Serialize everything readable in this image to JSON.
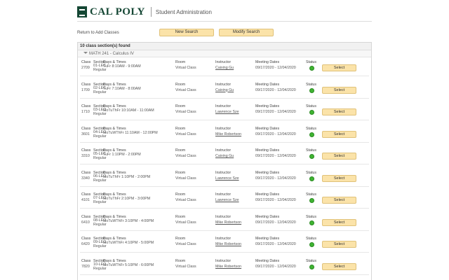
{
  "header": {
    "brand": "CAL POLY",
    "app_title": "Student Administration"
  },
  "toolbar": {
    "return_label": "Return to Add Classes",
    "new_search": "New Search",
    "modify_search": "Modify Search"
  },
  "results": {
    "count_label": "10 class section(s) found",
    "course_title": "MATH 241 - Calculus IV"
  },
  "columns": {
    "class": "Class",
    "section": "Section",
    "days_times": "Days & Times",
    "room": "Room",
    "instructor": "Instructor",
    "meeting_dates": "Meeting Dates",
    "status": "Status"
  },
  "select_label": "Select",
  "status_color": "#3fb432",
  "rows": [
    {
      "class": "2709",
      "section": "01-LEC Regular",
      "days": "TuFr 8:10AM - 9:00AM",
      "room": "Virtual Class",
      "instructor": "Caixing Gu",
      "dates": "09/17/2020 - 12/04/2020",
      "status": "open"
    },
    {
      "class": "1709",
      "section": "02-LEC Regular",
      "days": "TuFr 7:10AM - 8:00AM",
      "room": "Virtual Class",
      "instructor": "Caixing Gu",
      "dates": "09/17/2020 - 12/04/2020",
      "status": "open"
    },
    {
      "class": "1710",
      "section": "03-LEC Regular",
      "days": "MoTuThFr 10:10AM - 11:00AM",
      "room": "Virtual Class",
      "instructor": "Lawrence Sze",
      "dates": "09/17/2020 - 12/04/2020",
      "status": "open"
    },
    {
      "class": "3601",
      "section": "04-LEC Regular",
      "days": "MoTuWThFr 11:10AM - 12:00PM",
      "room": "Virtual Class",
      "instructor": "Mike Robertson",
      "dates": "09/17/2020 - 12/04/2020",
      "status": "open"
    },
    {
      "class": "3310",
      "section": "05-LEC Regular",
      "days": "TuFr 1:10PM - 2:00PM",
      "room": "Virtual Class",
      "instructor": "Caixing Gu",
      "dates": "09/17/2020 - 12/04/2020",
      "status": "open"
    },
    {
      "class": "3340",
      "section": "06-LEC Regular",
      "days": "MoTuThFr 1:10PM - 2:00PM",
      "room": "Virtual Class",
      "instructor": "Lawrence Sze",
      "dates": "09/17/2020 - 12/04/2020",
      "status": "open"
    },
    {
      "class": "4101",
      "section": "07-LEC Regular",
      "days": "MoTuThFr 2:10PM - 3:00PM",
      "room": "Virtual Class",
      "instructor": "Lawrence Sze",
      "dates": "09/17/2020 - 12/04/2020",
      "status": "open"
    },
    {
      "class": "6410",
      "section": "08-LEC Regular",
      "days": "MoTuWThFr 3:10PM - 4:00PM",
      "room": "Virtual Class",
      "instructor": "Mike Robertson",
      "dates": "09/17/2020 - 12/04/2020",
      "status": "open"
    },
    {
      "class": "6420",
      "section": "09-LEC Regular",
      "days": "MoTuWThFr 4:10PM - 5:00PM",
      "room": "Virtual Class",
      "instructor": "Mike Robertson",
      "dates": "09/17/2020 - 12/04/2020",
      "status": "open"
    },
    {
      "class": "7820",
      "section": "10-LEC Regular",
      "days": "MoTuWThFr 5:10PM - 6:00PM",
      "room": "Virtual Class",
      "instructor": "Mike Robertson",
      "dates": "09/17/2020 - 12/04/2020",
      "status": "open"
    }
  ]
}
